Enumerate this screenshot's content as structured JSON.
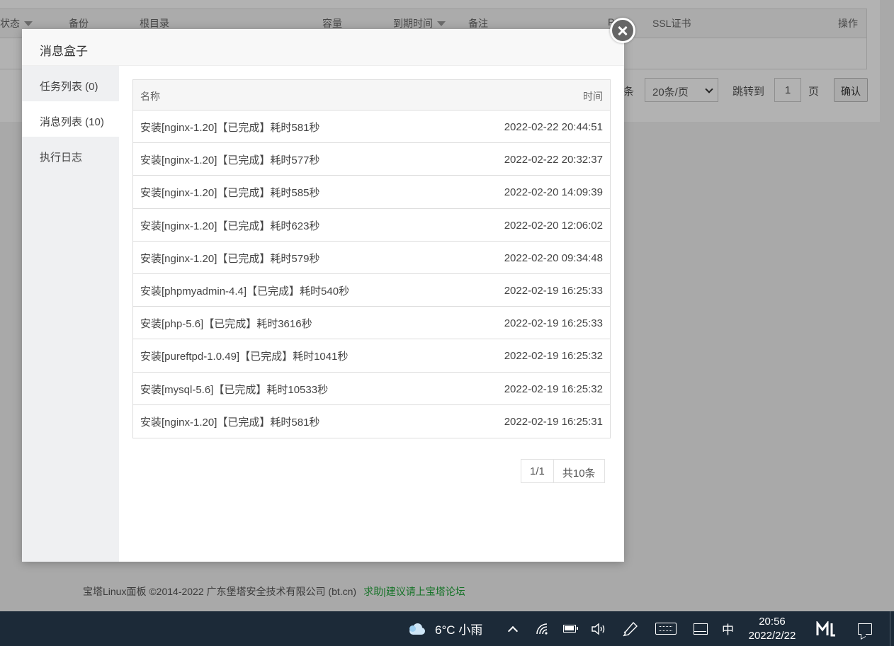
{
  "background": {
    "columns": [
      "状态",
      "备份",
      "根目录",
      "容量",
      "到期时间",
      "备注",
      "P",
      "SSL证书",
      "操作"
    ],
    "pagination": {
      "count_suffix": "条",
      "per_page": "20条/页",
      "goto_label": "跳转到",
      "goto_value": "1",
      "page_unit": "页",
      "confirm_label": "确认"
    },
    "footer": {
      "copyright": "宝塔Linux面板 ©2014-2022 广东堡塔安全技术有限公司 (bt.cn)",
      "links": "求助|建议请上宝塔论坛"
    }
  },
  "modal": {
    "title": "消息盒子",
    "tabs": [
      {
        "label": "任务列表 (0)",
        "active": false
      },
      {
        "label": "消息列表 (10)",
        "active": true
      },
      {
        "label": "执行日志",
        "active": false
      }
    ],
    "table": {
      "headers": {
        "name": "名称",
        "time": "时间"
      },
      "rows": [
        {
          "name": "安装[nginx-1.20]【已完成】耗时581秒",
          "time": "2022-02-22 20:44:51"
        },
        {
          "name": "安装[nginx-1.20]【已完成】耗时577秒",
          "time": "2022-02-22 20:32:37"
        },
        {
          "name": "安装[nginx-1.20]【已完成】耗时585秒",
          "time": "2022-02-20 14:09:39"
        },
        {
          "name": "安装[nginx-1.20]【已完成】耗时623秒",
          "time": "2022-02-20 12:06:02"
        },
        {
          "name": "安装[nginx-1.20]【已完成】耗时579秒",
          "time": "2022-02-20 09:34:48"
        },
        {
          "name": "安装[phpmyadmin-4.4]【已完成】耗时540秒",
          "time": "2022-02-19 16:25:33"
        },
        {
          "name": "安装[php-5.6]【已完成】耗时3616秒",
          "time": "2022-02-19 16:25:33"
        },
        {
          "name": "安装[pureftpd-1.0.49]【已完成】耗时1041秒",
          "time": "2022-02-19 16:25:32"
        },
        {
          "name": "安装[mysql-5.6]【已完成】耗时10533秒",
          "time": "2022-02-19 16:25:32"
        },
        {
          "name": "安装[nginx-1.20]【已完成】耗时581秒",
          "time": "2022-02-19 16:25:31"
        }
      ]
    },
    "pager": {
      "page": "1/1",
      "total": "共10条"
    }
  },
  "taskbar": {
    "weather": "6°C  小雨",
    "ime": "中",
    "time": "20:56",
    "date": "2022/2/22",
    "icons": [
      "weather-cloud-icon",
      "show-hidden-icons-chevron",
      "network-icon",
      "battery-icon",
      "volume-icon",
      "pen-icon",
      "keyboard-icon",
      "tablet-mode-icon",
      "app-m-icon",
      "notification-icon"
    ]
  },
  "colors": {
    "accent_green": "#20a53a",
    "taskbar_bg": "#1c2a38",
    "close_button": "#666666"
  }
}
